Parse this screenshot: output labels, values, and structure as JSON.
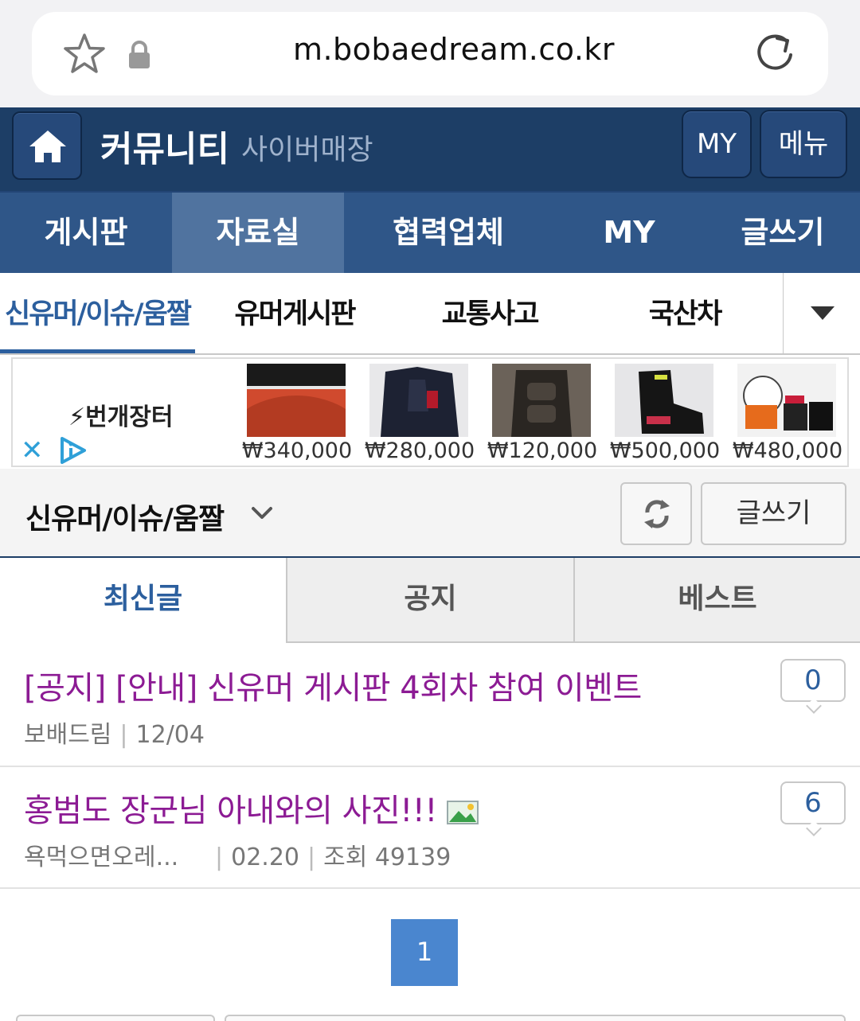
{
  "browser": {
    "url": "m.bobaedream.co.kr"
  },
  "header": {
    "title": "커뮤니티",
    "subtitle": "사이버매장",
    "my_label": "MY",
    "menu_label": "메뉴"
  },
  "main_nav": {
    "items": [
      {
        "label": "게시판",
        "active": false
      },
      {
        "label": "자료실",
        "active": true
      },
      {
        "label": "협력업체",
        "active": false
      },
      {
        "label": "MY",
        "active": false
      },
      {
        "label": "글쓰기",
        "active": false
      }
    ]
  },
  "category_tabs": {
    "items": [
      {
        "label": "신유머/이슈/움짤",
        "active": true
      },
      {
        "label": "유머게시판",
        "active": false
      },
      {
        "label": "교통사고",
        "active": false
      },
      {
        "label": "국산차",
        "active": false
      }
    ]
  },
  "ad": {
    "brand": "⚡번개장터",
    "close_glyph": "✕",
    "items": [
      {
        "price": "₩340,000",
        "icon": "tire-image"
      },
      {
        "price": "₩280,000",
        "icon": "jacket-image"
      },
      {
        "price": "₩120,000",
        "icon": "armor-image"
      },
      {
        "price": "₩500,000",
        "icon": "boots-image"
      },
      {
        "price": "₩480,000",
        "icon": "helmet-image"
      }
    ]
  },
  "board": {
    "title": "신유머/이슈/움짤",
    "write_label": "글쓰기"
  },
  "sub_tabs": {
    "items": [
      {
        "label": "최신글",
        "active": true
      },
      {
        "label": "공지",
        "active": false
      },
      {
        "label": "베스트",
        "active": false
      }
    ]
  },
  "posts": [
    {
      "title": "[공지] [안내] 신유머 게시판 4회차 참여 이벤트",
      "author": "보배드림",
      "date": "12/04",
      "comments": "0"
    },
    {
      "title": "홍범도 장군님 아내와의 사진!!!",
      "author": "욕먹으면오레...",
      "date": "02.20",
      "views": "조회 49139",
      "comments": "6"
    }
  ],
  "pagination": {
    "current": "1"
  },
  "colors": {
    "header_bg": "#1d3e66",
    "nav_bg": "#2f5688",
    "nav_active": "#50739f",
    "accent_blue": "#2c5f9e",
    "post_title": "#8c1b94",
    "page_button": "#4a86cf"
  }
}
